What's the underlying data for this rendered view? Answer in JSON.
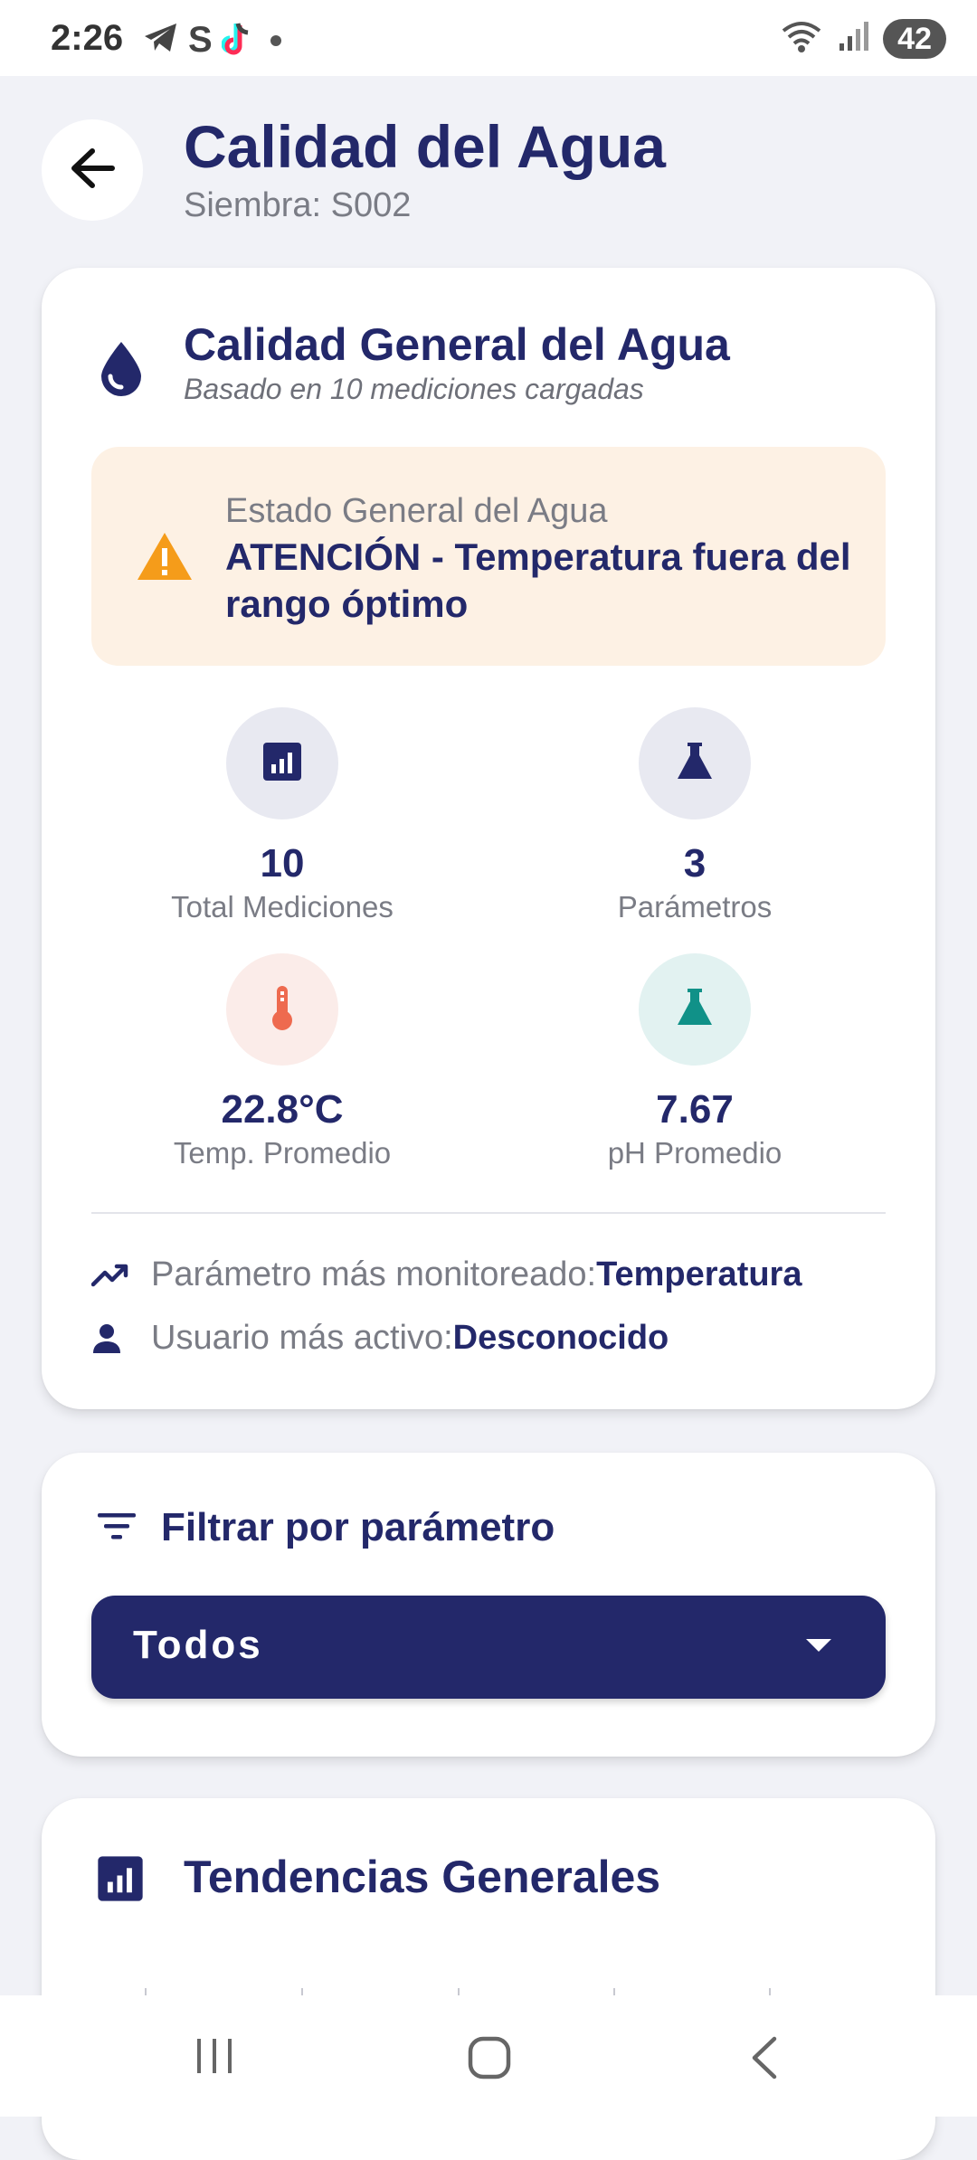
{
  "status_bar": {
    "time": "2:26",
    "battery": "42",
    "icons_left": [
      "telegram-icon",
      "s-icon",
      "tiktok-icon",
      "dot-icon"
    ],
    "icons_right": [
      "wifi-icon",
      "signal-icon",
      "battery-icon"
    ]
  },
  "header": {
    "title": "Calidad del Agua",
    "subtitle": "Siembra: S002"
  },
  "general_card": {
    "title": "Calidad General del Agua",
    "subtitle": "Basado en 10 mediciones cargadas",
    "alert": {
      "label": "Estado General del Agua",
      "text": "ATENCIÓN - Temperatura fuera del rango óptimo",
      "background": "#fdf1e4",
      "icon_color": "#f59c1a"
    },
    "stats": [
      {
        "icon": "bar-chart-icon",
        "value": "10",
        "label": "Total Mediciones",
        "bg": "#e8e9f1",
        "color": "#23286a"
      },
      {
        "icon": "flask-icon",
        "value": "3",
        "label": "Parámetros",
        "bg": "#e8e9f1",
        "color": "#23286a"
      },
      {
        "icon": "thermometer-icon",
        "value": "22.8°C",
        "label": "Temp. Promedio",
        "bg": "#fbece9",
        "color": "#ee6a4f"
      },
      {
        "icon": "flask-icon",
        "value": "7.67",
        "label": "pH Promedio",
        "bg": "#e2f2f1",
        "color": "#109188"
      }
    ],
    "most_monitored": {
      "label": "Parámetro más monitoreado: ",
      "value": "Temperatura"
    },
    "most_active": {
      "label": "Usuario más activo: ",
      "value": "Desconocido"
    }
  },
  "filter_card": {
    "title": "Filtrar por parámetro",
    "selected": "Todos"
  },
  "trends_card": {
    "title": "Tendencias Generales"
  },
  "colors": {
    "primary": "#23286a",
    "background": "#f1f2f7",
    "muted_text": "#7a7c85"
  }
}
